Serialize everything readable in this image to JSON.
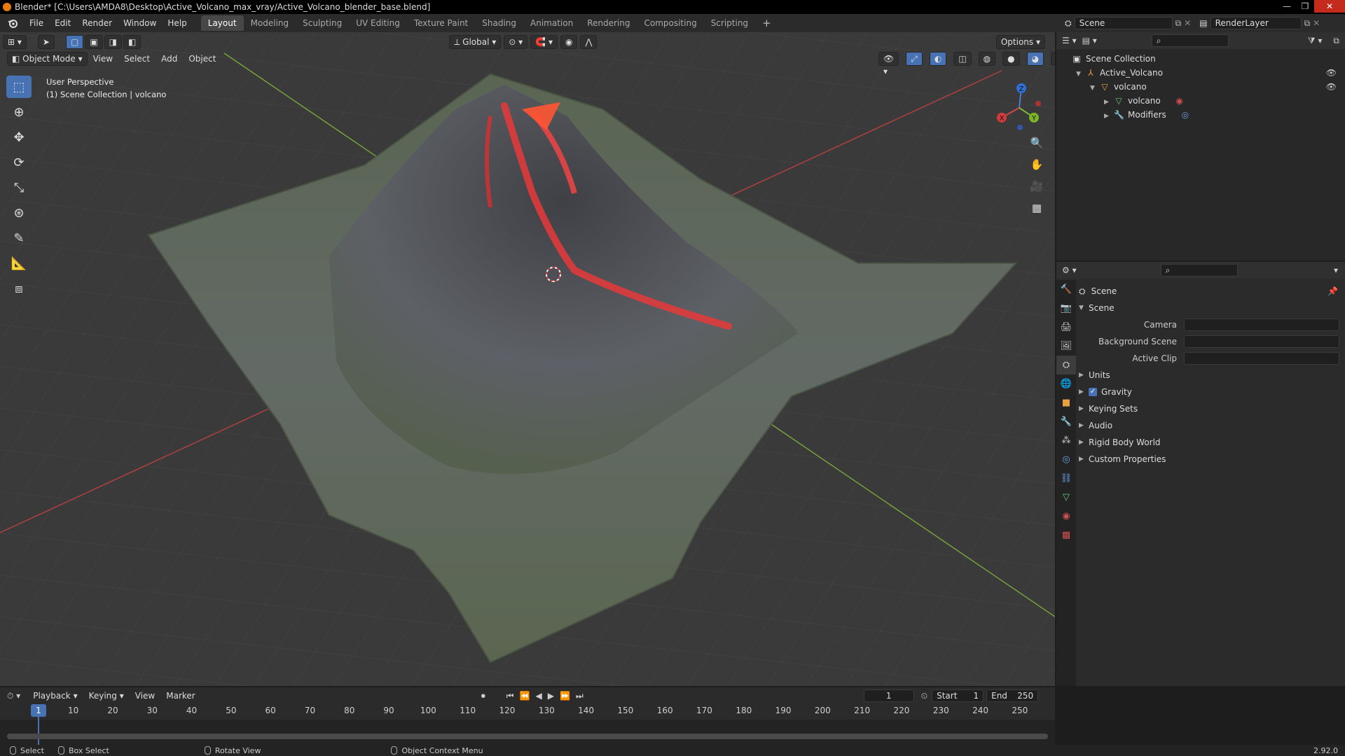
{
  "window": {
    "title": "Blender* [C:\\Users\\AMDA8\\Desktop\\Active_Volcano_max_vray/Active_Volcano_blender_base.blend]"
  },
  "menu": [
    "File",
    "Edit",
    "Render",
    "Window",
    "Help"
  ],
  "workspaces": [
    {
      "label": "Layout",
      "active": true
    },
    {
      "label": "Modeling"
    },
    {
      "label": "Sculpting"
    },
    {
      "label": "UV Editing"
    },
    {
      "label": "Texture Paint"
    },
    {
      "label": "Shading"
    },
    {
      "label": "Animation"
    },
    {
      "label": "Rendering"
    },
    {
      "label": "Compositing"
    },
    {
      "label": "Scripting"
    }
  ],
  "scene_selector": {
    "scene": "Scene",
    "view_layer": "RenderLayer"
  },
  "viewport": {
    "mode": "Object Mode",
    "menus": [
      "View",
      "Select",
      "Add",
      "Object"
    ],
    "orientation": "Global",
    "options_label": "Options",
    "info_line1": "User Perspective",
    "info_line2": "(1) Scene Collection | volcano",
    "gizmo": {
      "x": "X",
      "y": "Y",
      "z": "Z"
    }
  },
  "outliner": {
    "root": "Scene Collection",
    "items": [
      {
        "label": "Active_Volcano",
        "depth": 1
      },
      {
        "label": "volcano",
        "depth": 2
      },
      {
        "label": "volcano",
        "depth": 3
      },
      {
        "label": "Modifiers",
        "depth": 3
      }
    ]
  },
  "properties": {
    "context": "Scene",
    "section": "Scene",
    "fields": [
      {
        "label": "Camera"
      },
      {
        "label": "Background Scene"
      },
      {
        "label": "Active Clip"
      }
    ],
    "panels": [
      "Units",
      "Gravity",
      "Keying Sets",
      "Audio",
      "Rigid Body World",
      "Custom Properties"
    ]
  },
  "timeline": {
    "menus": [
      "Playback",
      "Keying",
      "View",
      "Marker"
    ],
    "current_frame": "1",
    "start_label": "Start",
    "start": "1",
    "end_label": "End",
    "end": "250",
    "ticks": [
      "1",
      "10",
      "20",
      "30",
      "40",
      "50",
      "60",
      "70",
      "80",
      "90",
      "100",
      "110",
      "120",
      "130",
      "140",
      "150",
      "160",
      "170",
      "180",
      "190",
      "200",
      "210",
      "220",
      "230",
      "240",
      "250"
    ]
  },
  "status": {
    "select": "Select",
    "box_select": "Box Select",
    "rotate_view": "Rotate View",
    "context_menu": "Object Context Menu",
    "version": "2.92.0"
  }
}
